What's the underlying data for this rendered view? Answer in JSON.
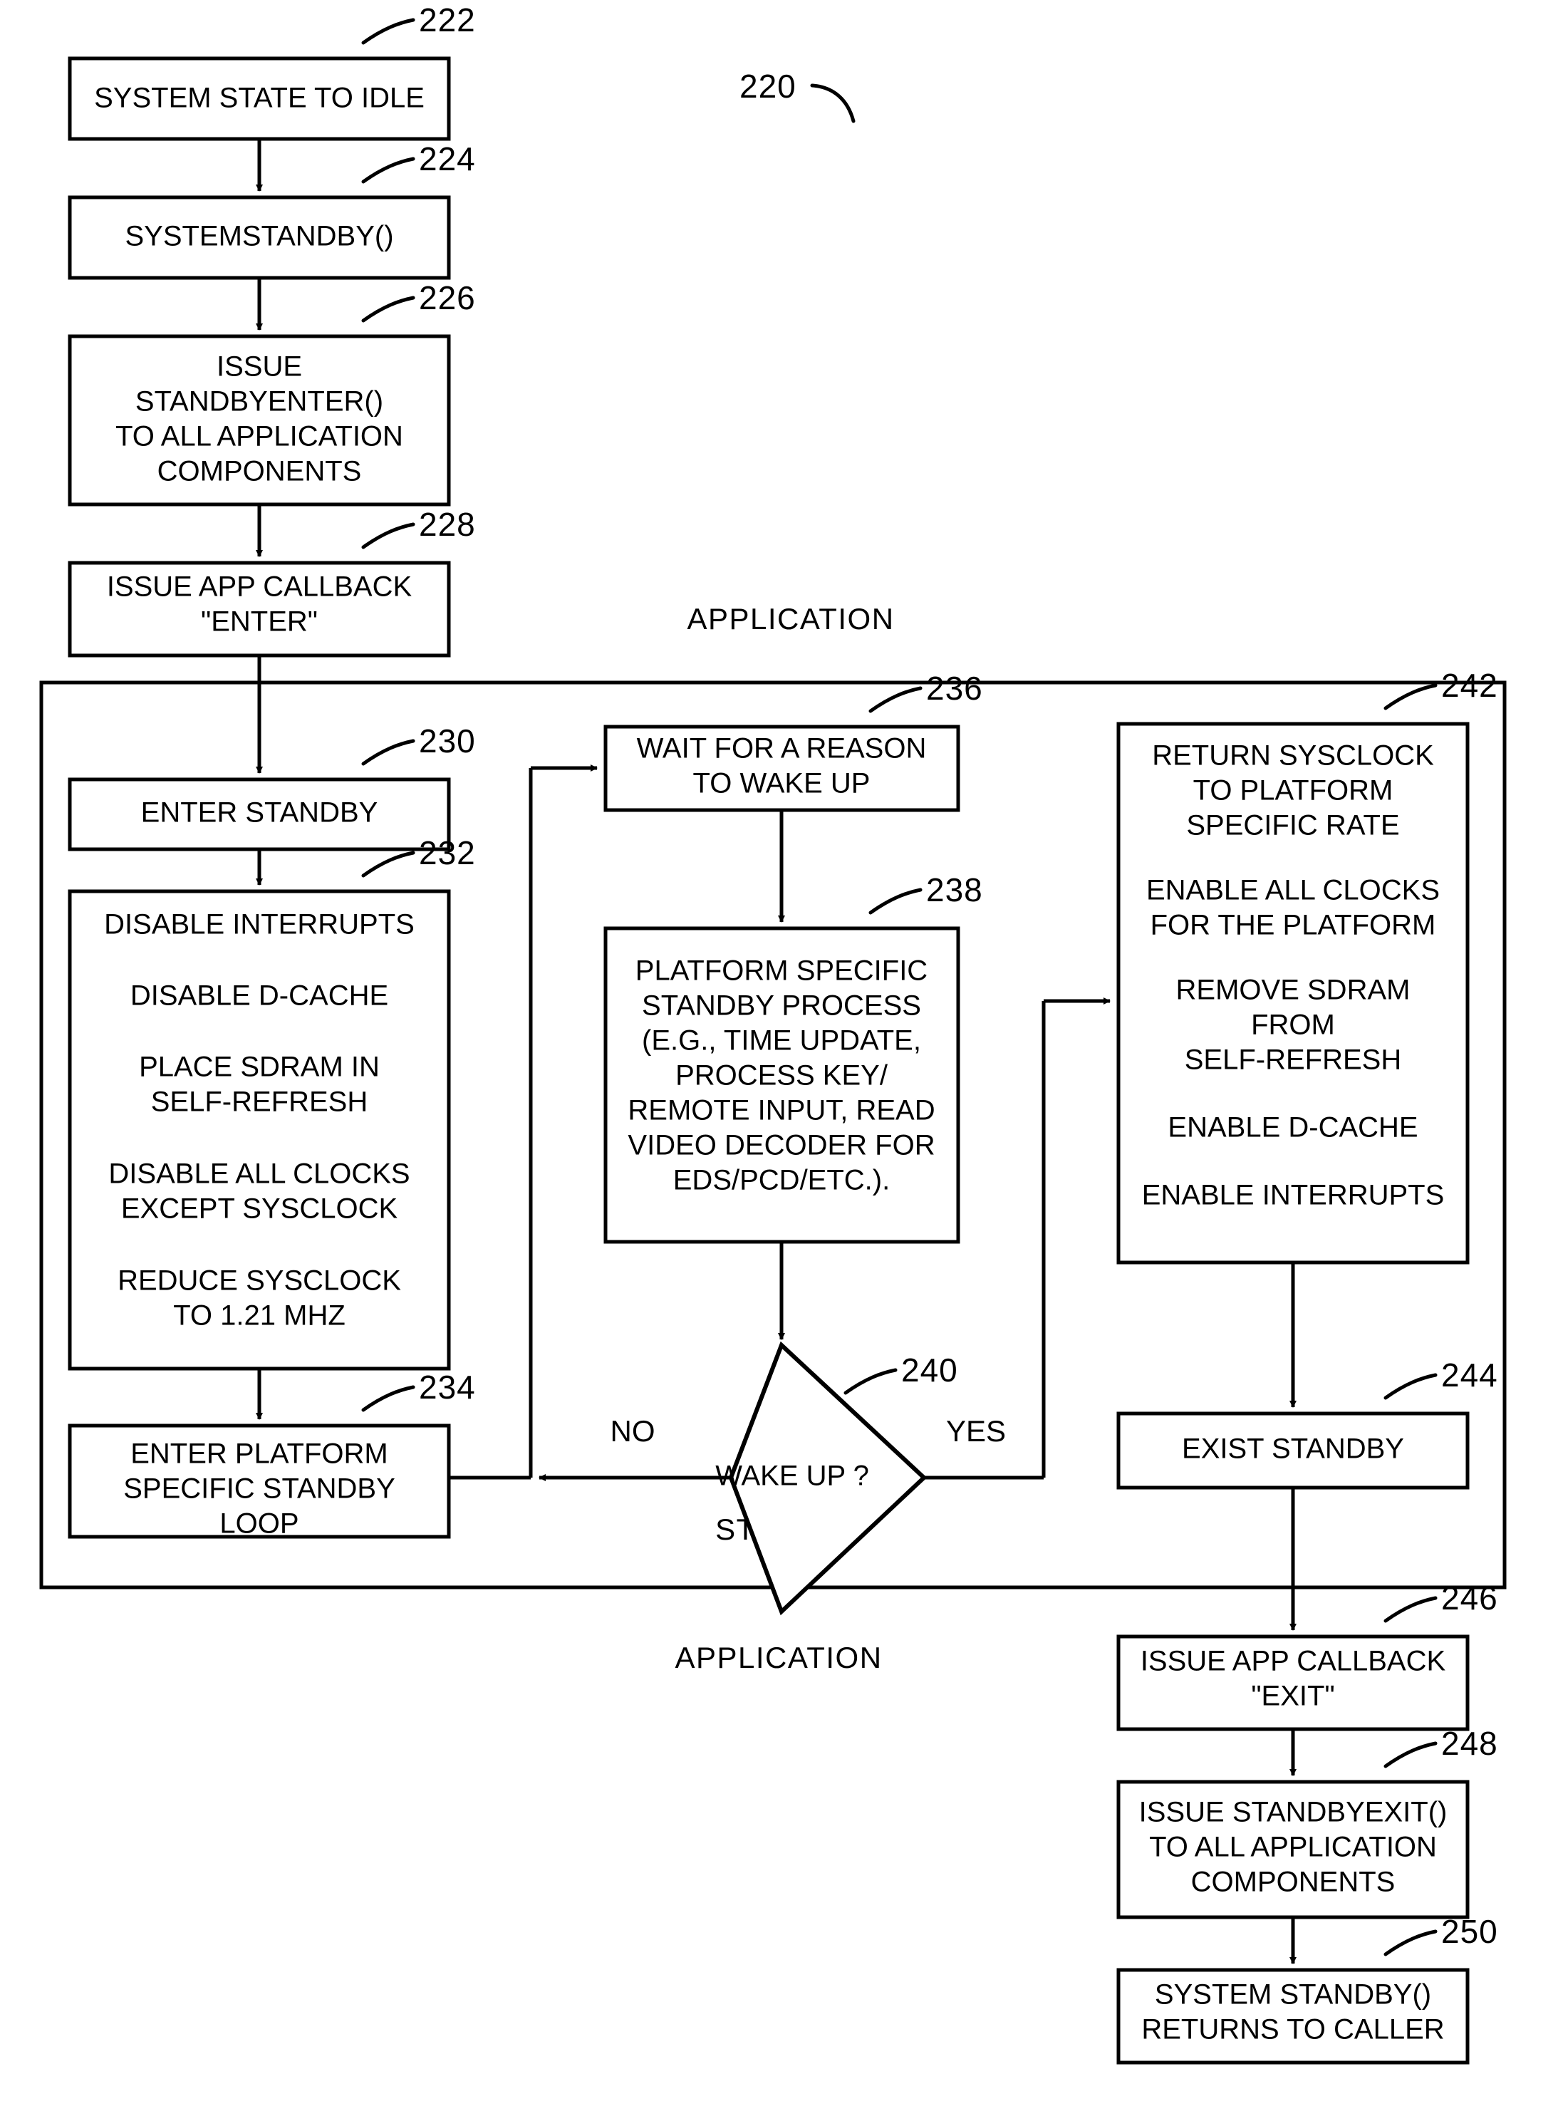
{
  "figure": {
    "figure_ref": "220",
    "zone_labels": [
      {
        "id": "application-top",
        "text": "APPLICATION"
      },
      {
        "id": "standby-inner",
        "text": "STANDBY"
      },
      {
        "id": "application-bottom",
        "text": "APPLICATION"
      }
    ],
    "edge_labels": {
      "no": "NO",
      "yes": "YES"
    },
    "nodes": [
      {
        "ref": "222",
        "name": "system-state-to-idle",
        "lines": [
          "SYSTEM STATE TO IDLE"
        ]
      },
      {
        "ref": "224",
        "name": "systemstandby-call",
        "lines": [
          "SYSTEMSTANDBY()"
        ]
      },
      {
        "ref": "226",
        "name": "issue-standbyenter",
        "lines": [
          "ISSUE",
          "STANDBYENTER()",
          "TO ALL APPLICATION",
          "COMPONENTS"
        ]
      },
      {
        "ref": "228",
        "name": "issue-app-callback-enter",
        "lines": [
          "ISSUE APP CALLBACK",
          "\"ENTER\""
        ]
      },
      {
        "ref": "230",
        "name": "enter-standby",
        "lines": [
          "ENTER STANDBY"
        ]
      },
      {
        "ref": "232",
        "name": "disable-interrupts-block",
        "lines": [
          "DISABLE INTERRUPTS",
          "",
          "DISABLE D-CACHE",
          "",
          "PLACE SDRAM IN",
          "SELF-REFRESH",
          "",
          "DISABLE ALL CLOCKS",
          "EXCEPT SYSCLOCK",
          "",
          "REDUCE SYSCLOCK",
          "TO 1.21 MHZ"
        ]
      },
      {
        "ref": "234",
        "name": "enter-platform-specific-standby-loop",
        "lines": [
          "ENTER PLATFORM",
          "SPECIFIC STANDBY",
          "LOOP"
        ]
      },
      {
        "ref": "236",
        "name": "wait-for-reason-to-wake-up",
        "lines": [
          "WAIT FOR A REASON",
          "TO WAKE UP"
        ]
      },
      {
        "ref": "238",
        "name": "platform-specific-standby-process",
        "lines": [
          "PLATFORM SPECIFIC",
          "STANDBY PROCESS",
          "(E.G., TIME UPDATE,",
          "PROCESS KEY/",
          "REMOTE INPUT, READ",
          "VIDEO DECODER FOR",
          "EDS/PCD/ETC.)."
        ]
      },
      {
        "ref": "240",
        "name": "wake-up-decision",
        "lines": [
          "WAKE UP ?"
        ]
      },
      {
        "ref": "242",
        "name": "return-sysclock-block",
        "lines": [
          "RETURN SYSCLOCK",
          "TO PLATFORM",
          "SPECIFIC RATE",
          "",
          "ENABLE ALL CLOCKS",
          "FOR THE PLATFORM",
          "",
          "REMOVE SDRAM",
          "FROM",
          "SELF-REFRESH",
          "",
          "ENABLE D-CACHE",
          "",
          "ENABLE INTERRUPTS"
        ]
      },
      {
        "ref": "244",
        "name": "exist-standby",
        "lines": [
          "EXIST STANDBY"
        ]
      },
      {
        "ref": "246",
        "name": "issue-app-callback-exit",
        "lines": [
          "ISSUE APP CALLBACK",
          "\"EXIT\""
        ]
      },
      {
        "ref": "248",
        "name": "issue-standbyexit",
        "lines": [
          "ISSUE STANDBYEXIT()",
          "TO ALL APPLICATION",
          "COMPONENTS"
        ]
      },
      {
        "ref": "250",
        "name": "system-standby-returns",
        "lines": [
          "SYSTEM STANDBY()",
          "RETURNS TO CALLER"
        ]
      }
    ]
  },
  "n222": {
    "l0": "SYSTEM STATE TO IDLE",
    "ref": "222"
  },
  "n224": {
    "l0": "SYSTEMSTANDBY()",
    "ref": "224"
  },
  "n226": {
    "l0": "ISSUE",
    "l1": "STANDBYENTER()",
    "l2": "TO ALL APPLICATION",
    "l3": "COMPONENTS",
    "ref": "226"
  },
  "n228": {
    "l0": "ISSUE APP CALLBACK",
    "l1": "\"ENTER\"",
    "ref": "228"
  },
  "n230": {
    "l0": "ENTER STANDBY",
    "ref": "230"
  },
  "n232": {
    "l0": "DISABLE INTERRUPTS",
    "l1": "DISABLE D-CACHE",
    "l2": "PLACE SDRAM IN",
    "l3": "SELF-REFRESH",
    "l4": "DISABLE ALL CLOCKS",
    "l5": "EXCEPT SYSCLOCK",
    "l6": "REDUCE SYSCLOCK",
    "l7": "TO 1.21 MHZ",
    "ref": "232"
  },
  "n234": {
    "l0": "ENTER PLATFORM",
    "l1": "SPECIFIC STANDBY",
    "l2": "LOOP",
    "ref": "234"
  },
  "n236": {
    "l0": "WAIT FOR A REASON",
    "l1": "TO WAKE UP",
    "ref": "236"
  },
  "n238": {
    "l0": "PLATFORM SPECIFIC",
    "l1": "STANDBY PROCESS",
    "l2": "(E.G., TIME UPDATE,",
    "l3": "PROCESS KEY/",
    "l4": "REMOTE INPUT, READ",
    "l5": "VIDEO DECODER FOR",
    "l6": "EDS/PCD/ETC.).",
    "ref": "238"
  },
  "n240": {
    "l0": "WAKE UP ?",
    "ref": "240"
  },
  "n242": {
    "l0": "RETURN SYSCLOCK",
    "l1": "TO PLATFORM",
    "l2": "SPECIFIC RATE",
    "l3": "ENABLE ALL CLOCKS",
    "l4": "FOR THE PLATFORM",
    "l5": "REMOVE SDRAM",
    "l6": "FROM",
    "l7": "SELF-REFRESH",
    "l8": "ENABLE D-CACHE",
    "l9": "ENABLE INTERRUPTS",
    "ref": "242"
  },
  "n244": {
    "l0": "EXIST STANDBY",
    "ref": "244"
  },
  "n246": {
    "l0": "ISSUE APP CALLBACK",
    "l1": "\"EXIT\"",
    "ref": "246"
  },
  "n248": {
    "l0": "ISSUE STANDBYEXIT()",
    "l1": "TO ALL APPLICATION",
    "l2": "COMPONENTS",
    "ref": "248"
  },
  "n250": {
    "l0": "SYSTEM STANDBY()",
    "l1": "RETURNS TO CALLER",
    "ref": "250"
  },
  "labels": {
    "fig": "220",
    "app_top": "APPLICATION",
    "app_bottom": "APPLICATION",
    "standby": "STANDBY",
    "no": "NO",
    "yes": "YES"
  }
}
